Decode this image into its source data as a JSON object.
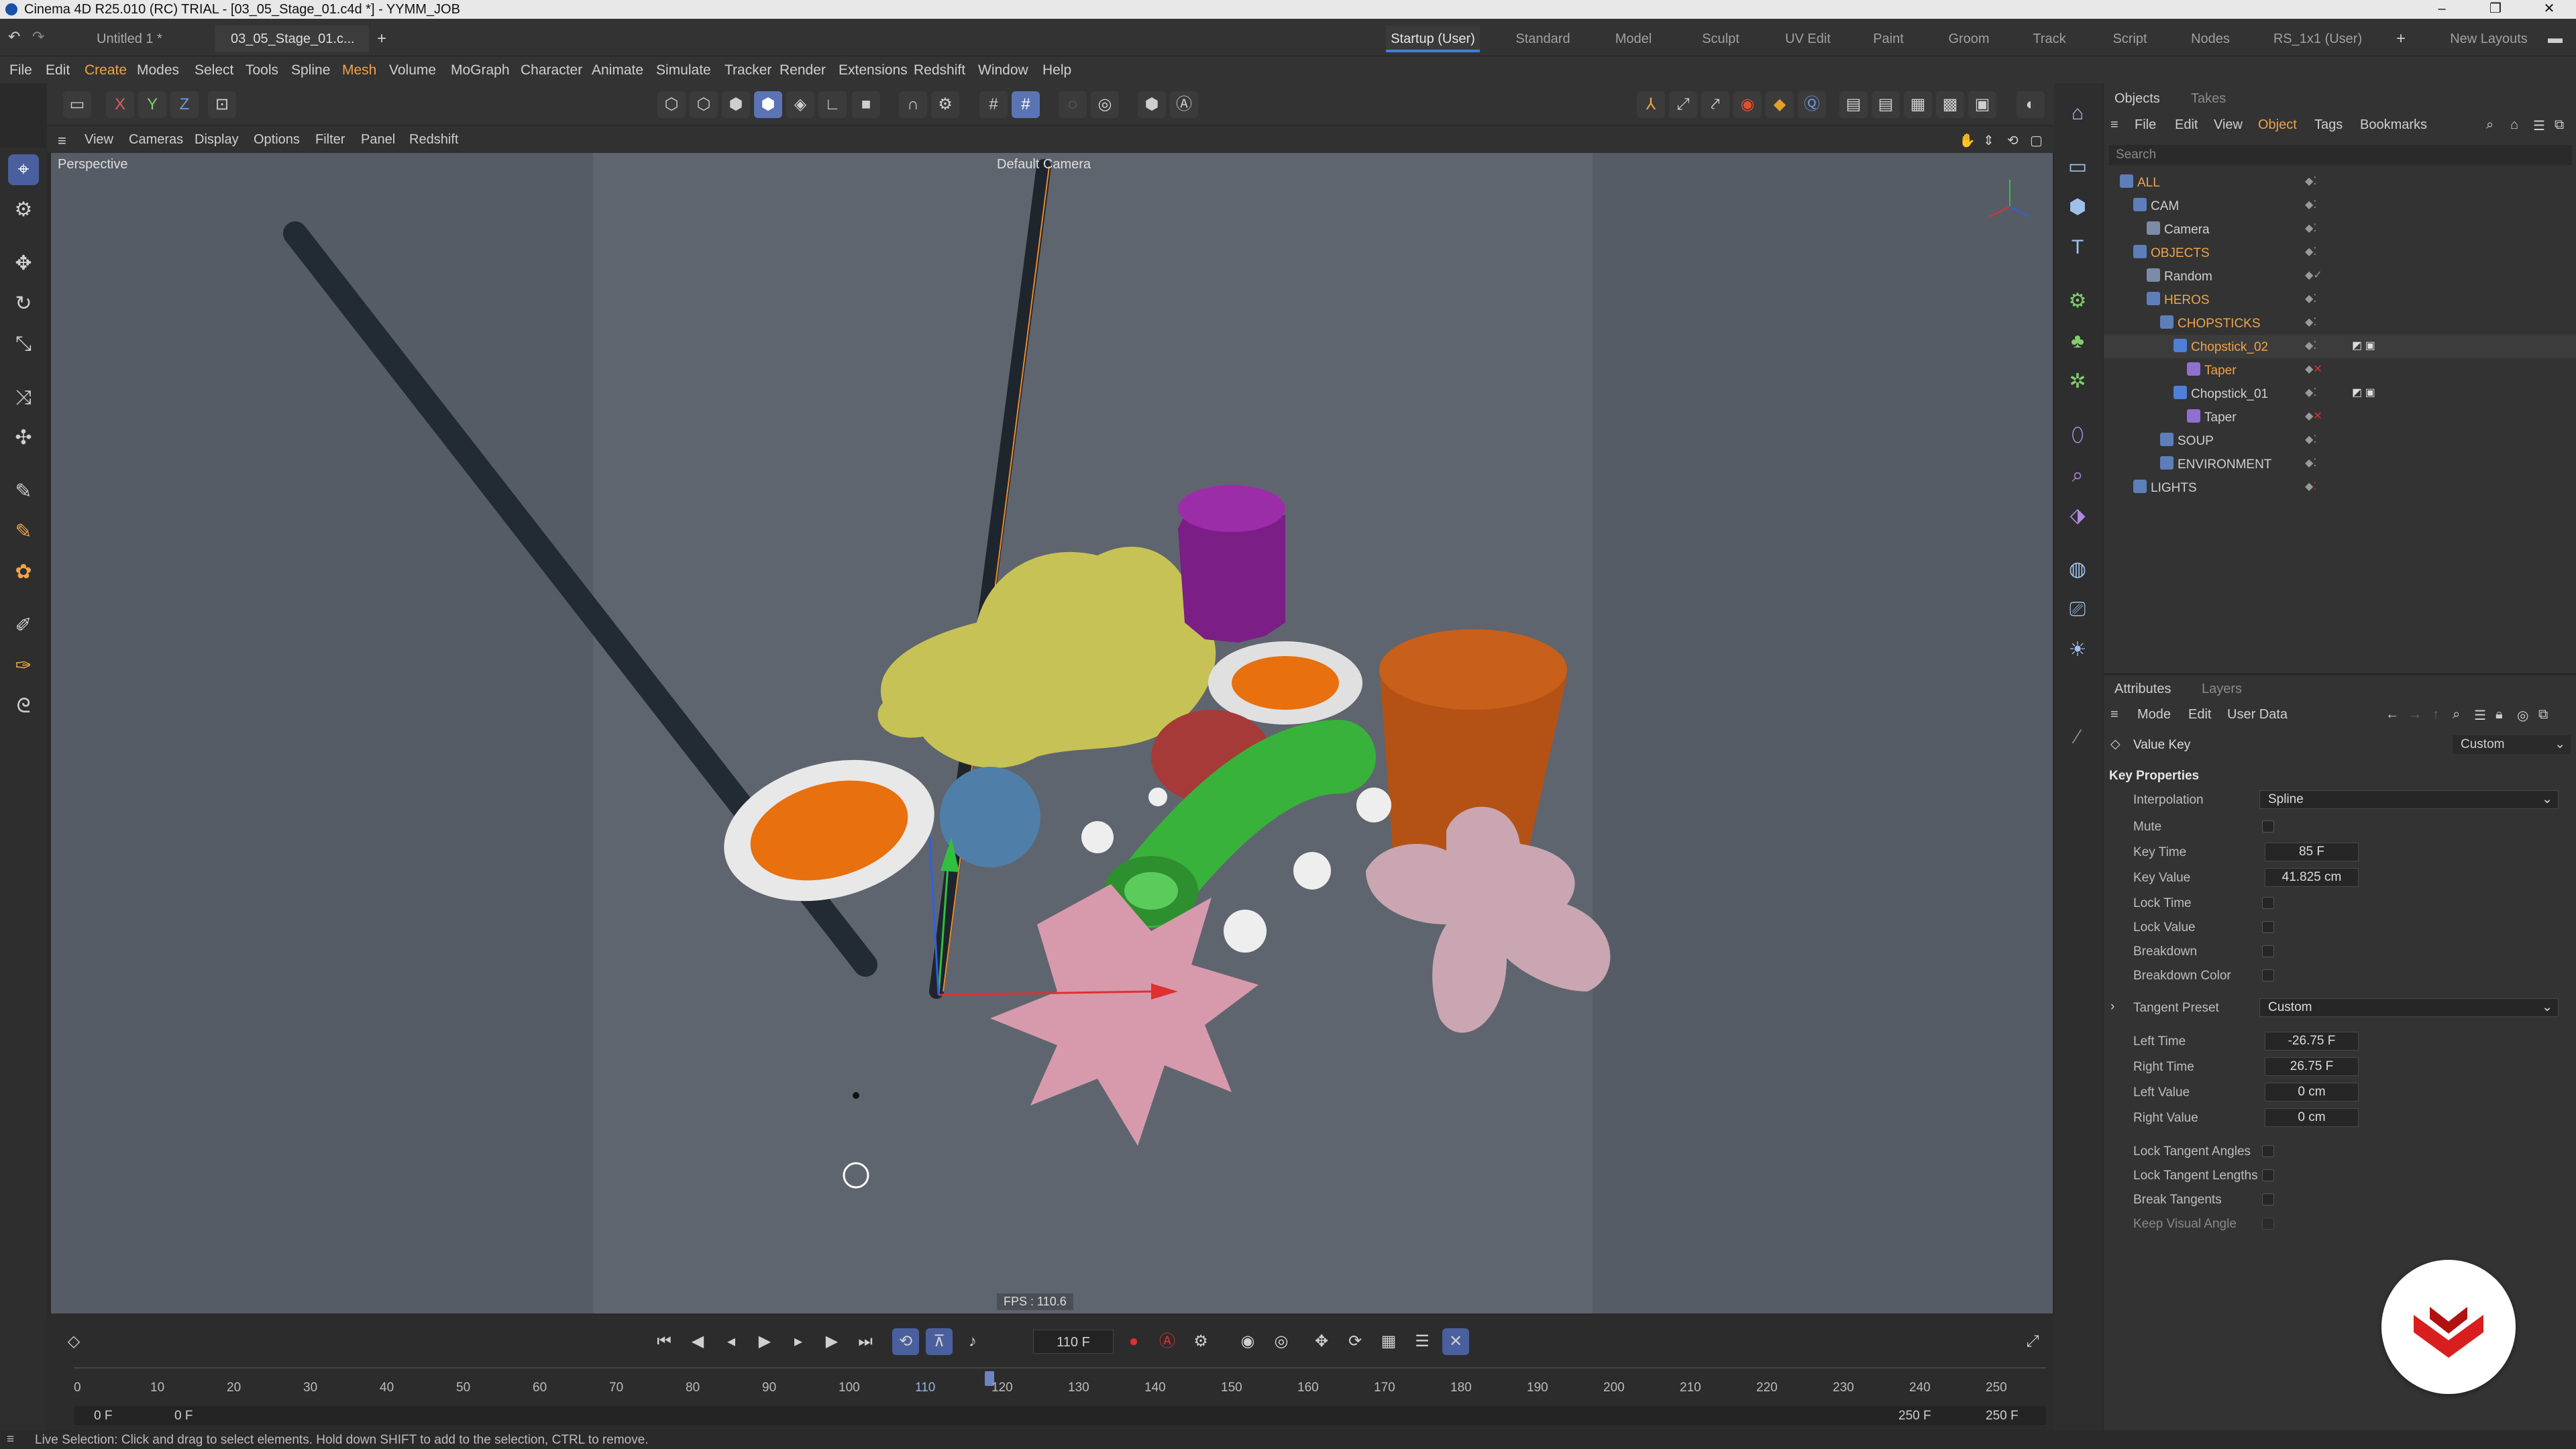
{
  "window": {
    "title": "Cinema 4D R25.010 (RC) TRIAL - [03_05_Stage_01.c4d *] - YYMM_JOB"
  },
  "doc_tabs": [
    "Untitled 1 *",
    "03_05_Stage_01.c..."
  ],
  "layouts": [
    "Startup (User)",
    "Standard",
    "Model",
    "Sculpt",
    "UV Edit",
    "Paint",
    "Groom",
    "Track",
    "Script",
    "Nodes",
    "RS_1x1 (User)"
  ],
  "new_layouts": "New Layouts",
  "menu": [
    "File",
    "Edit",
    "Create",
    "Modes",
    "Select",
    "Tools",
    "Spline",
    "Mesh",
    "Volume",
    "MoGraph",
    "Character",
    "Animate",
    "Simulate",
    "Tracker",
    "Render",
    "Extensions",
    "Redshift",
    "Window",
    "Help"
  ],
  "axis_labels": {
    "x": "X",
    "y": "Y",
    "z": "Z"
  },
  "viewport_menu": [
    "View",
    "Cameras",
    "Display",
    "Options",
    "Filter",
    "Panel",
    "Redshift"
  ],
  "viewport": {
    "label": "Perspective",
    "camera": "Default Camera",
    "fps": "FPS : 110.6"
  },
  "timeline": {
    "current_frame": "110 F",
    "ticks": [
      "0",
      "10",
      "20",
      "30",
      "40",
      "50",
      "60",
      "70",
      "80",
      "90",
      "100",
      "110",
      "120",
      "130",
      "140",
      "150",
      "160",
      "170",
      "180",
      "190",
      "200",
      "210",
      "220",
      "230",
      "240",
      "250"
    ],
    "start": "0 F",
    "start2": "0 F",
    "end": "250 F",
    "end2": "250 F"
  },
  "status": "Live Selection: Click and drag to select elements. Hold down SHIFT to add to the selection, CTRL to remove.",
  "objects_panel": {
    "tabs": [
      "Objects",
      "Takes"
    ],
    "menu": [
      "File",
      "Edit",
      "View",
      "Object",
      "Tags",
      "Bookmarks"
    ],
    "search_placeholder": "Search",
    "tree": [
      {
        "name": "ALL",
        "depth": 0,
        "color": "#f0a34a"
      },
      {
        "name": "CAM",
        "depth": 1,
        "color": "#cfcfcf"
      },
      {
        "name": "Camera",
        "depth": 2,
        "color": "#cfcfcf"
      },
      {
        "name": "OBJECTS",
        "depth": 1,
        "color": "#f0a34a"
      },
      {
        "name": "Random",
        "depth": 2,
        "color": "#cfcfcf"
      },
      {
        "name": "HEROS",
        "depth": 2,
        "color": "#f0a34a"
      },
      {
        "name": "CHOPSTICKS",
        "depth": 3,
        "color": "#f0a34a"
      },
      {
        "name": "Chopstick_02",
        "depth": 4,
        "color": "#f0a34a"
      },
      {
        "name": "Taper",
        "depth": 5,
        "color": "#f0a34a"
      },
      {
        "name": "Chopstick_01",
        "depth": 4,
        "color": "#cfcfcf"
      },
      {
        "name": "Taper",
        "depth": 5,
        "color": "#cfcfcf"
      },
      {
        "name": "SOUP",
        "depth": 3,
        "color": "#cfcfcf"
      },
      {
        "name": "ENVIRONMENT",
        "depth": 3,
        "color": "#cfcfcf"
      },
      {
        "name": "LIGHTS",
        "depth": 1,
        "color": "#cfcfcf"
      }
    ]
  },
  "attributes_panel": {
    "tabs": [
      "Attributes",
      "Layers"
    ],
    "menu": [
      "Mode",
      "Edit",
      "User Data"
    ],
    "header": "Value Key",
    "header_dropdown": "Custom",
    "section": "Key Properties",
    "interpolation_label": "Interpolation",
    "interpolation": "Spline",
    "mute": "Mute",
    "key_time_label": "Key Time",
    "key_time": "85 F",
    "key_value_label": "Key Value",
    "key_value": "41.825 cm",
    "lock_time": "Lock Time",
    "lock_value": "Lock Value",
    "breakdown": "Breakdown",
    "breakdown_color": "Breakdown Color",
    "tangent_preset_label": "Tangent Preset",
    "tangent_preset": "Custom",
    "left_time_label": "Left  Time",
    "left_time": "-26.75 F",
    "right_time_label": "Right Time",
    "right_time": "26.75 F",
    "left_value_label": "Left  Value",
    "left_value": "0 cm",
    "right_value_label": "Right Value",
    "right_value": "0 cm",
    "lock_tangent_angles": "Lock Tangent Angles",
    "lock_tangent_lengths": "Lock Tangent Lengths",
    "break_tangents": "Break Tangents",
    "keep_visual_angle": "Keep Visual Angle"
  }
}
